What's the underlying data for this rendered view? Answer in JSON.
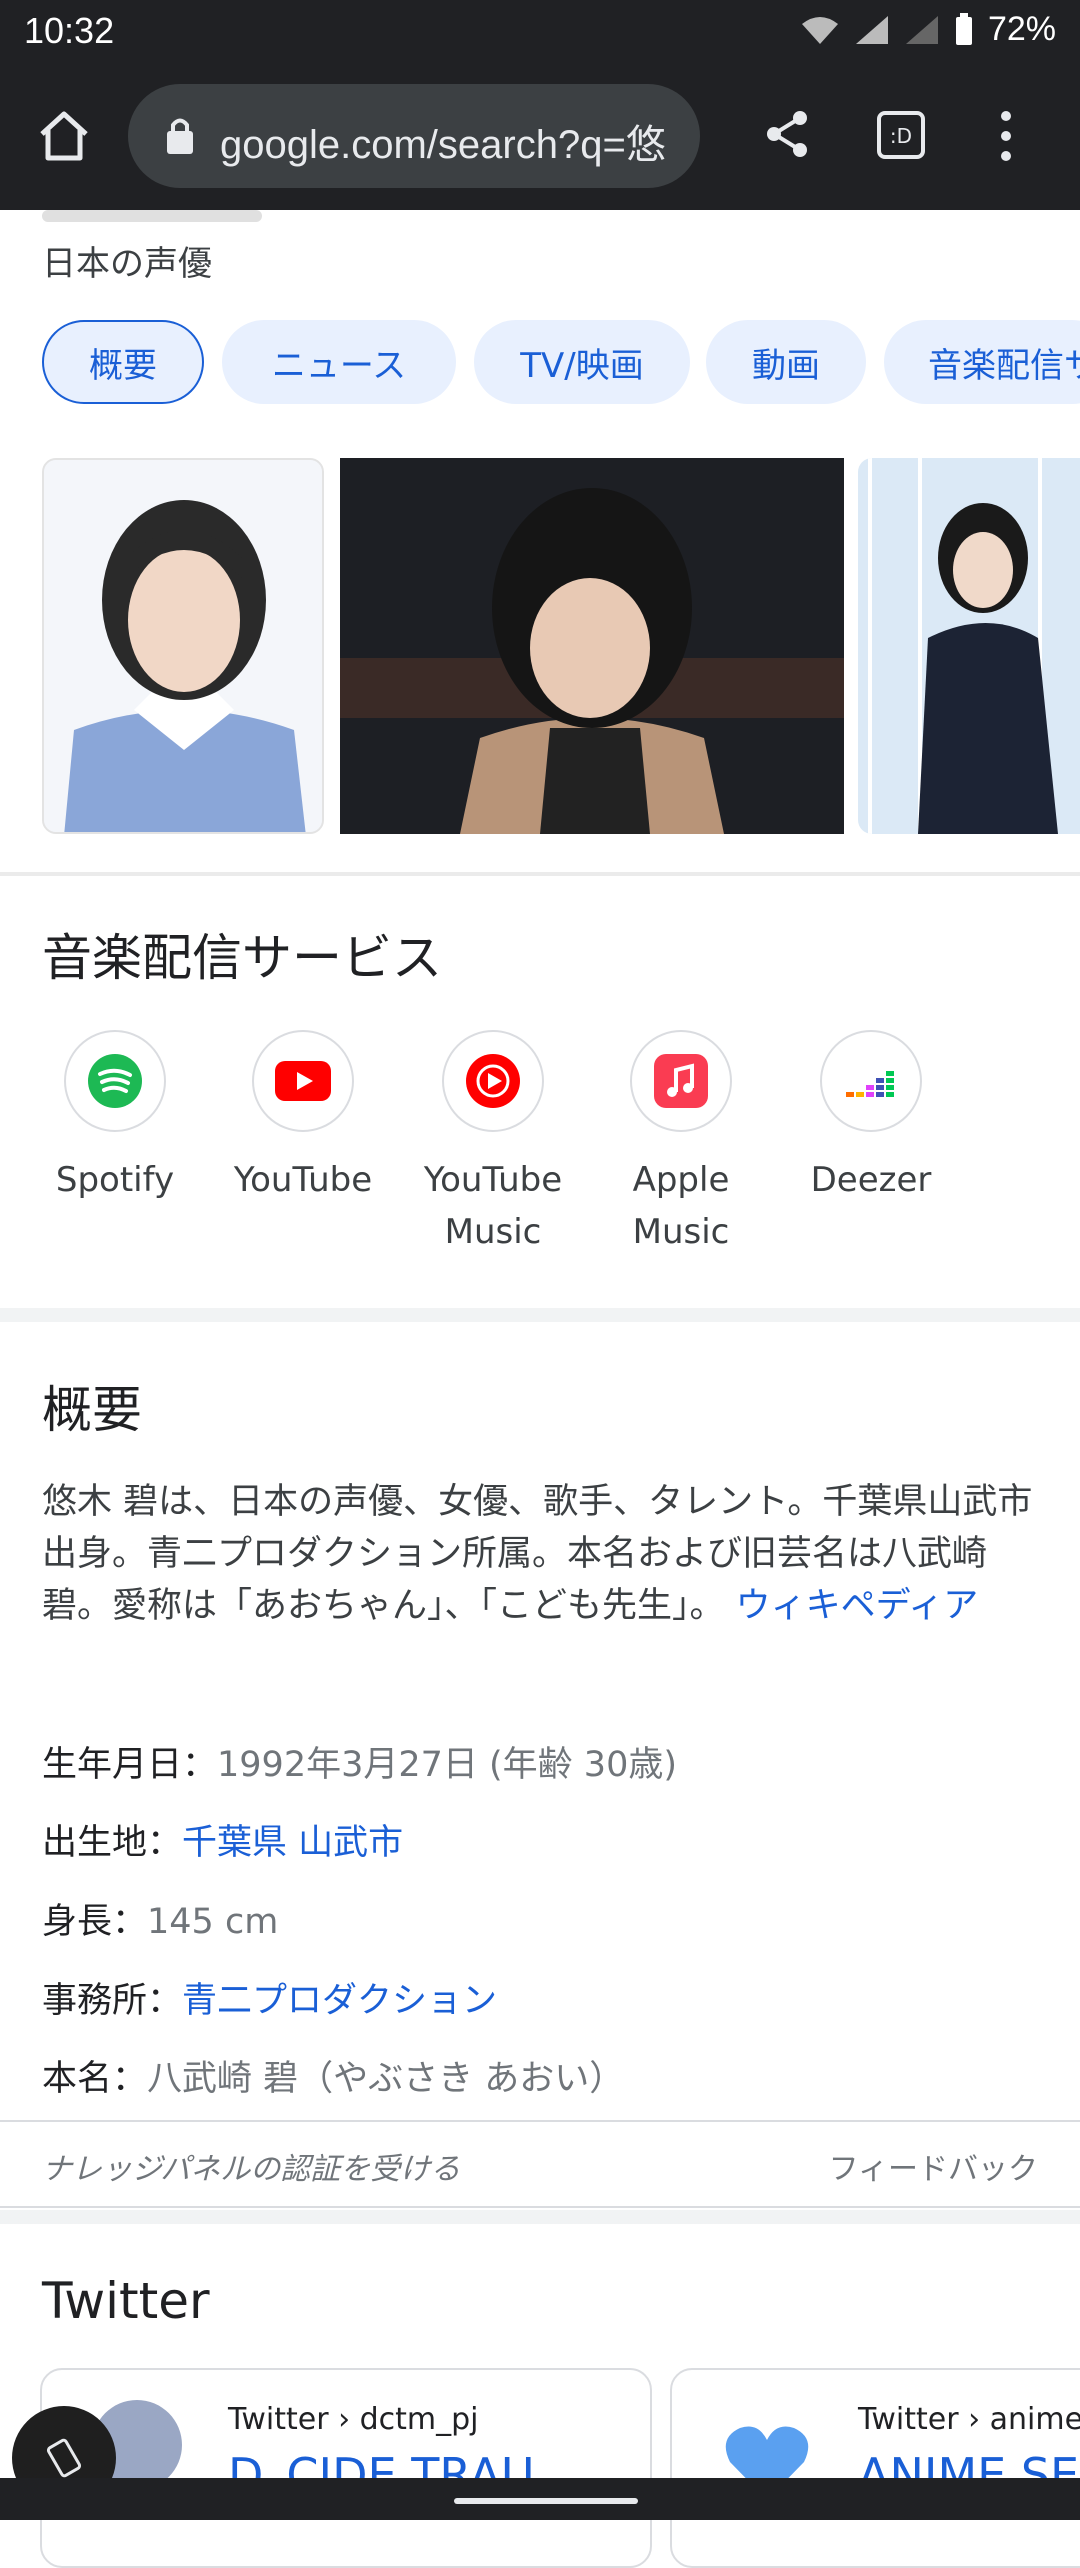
{
  "status_bar": {
    "time": "10:32",
    "battery": "72%"
  },
  "browser": {
    "url": "google.com/search?q=悠"
  },
  "panel": {
    "subtitle": "日本の声優",
    "chips": [
      "概要",
      "ニュース",
      "TV/映画",
      "動画",
      "音楽配信サ"
    ]
  },
  "music": {
    "title": "音楽配信サービス",
    "services": [
      {
        "name": "Spotify",
        "icon": "spotify-icon",
        "color": "#1db954"
      },
      {
        "name": "YouTube",
        "icon": "youtube-icon",
        "color": "#ff0000"
      },
      {
        "name": "YouTube Music",
        "icon": "youtube-music-icon",
        "color": "#ff0000"
      },
      {
        "name": "Apple Music",
        "icon": "apple-music-icon",
        "color": "#fa3c52"
      },
      {
        "name": "Deezer",
        "icon": "deezer-icon",
        "color": "#ff6d00"
      }
    ]
  },
  "overview": {
    "title": "概要",
    "text": "悠木 碧は、日本の声優、女優、歌手、タレント。千葉県山武市出身。青二プロダクション所属。本名および旧芸名は八武崎 碧。愛称は「あおちゃん」、「こども先生」。",
    "source_link": "ウィキペディア"
  },
  "facts": {
    "born": {
      "label": "生年月日：",
      "value": "1992年3月27日 (年齢 30歳)"
    },
    "birthplace": {
      "label": "出生地：",
      "value": "千葉県 山武市"
    },
    "height": {
      "label": "身長：",
      "value": "145 cm"
    },
    "agency": {
      "label": "事務所：",
      "value": "青二プロダクション"
    },
    "real_name": {
      "label": "本名：",
      "value": "八武崎 碧（やぶさき あおい）"
    }
  },
  "footer": {
    "claim": "ナレッジパネルの認証を受ける",
    "feedback": "フィードバック"
  },
  "twitter": {
    "title": "Twitter",
    "cards": [
      {
        "source": "Twitter › dctm_pj",
        "headline": "D_CIDE TRAU"
      },
      {
        "source": "Twitter › animes",
        "headline": "ANIME SE"
      }
    ]
  }
}
